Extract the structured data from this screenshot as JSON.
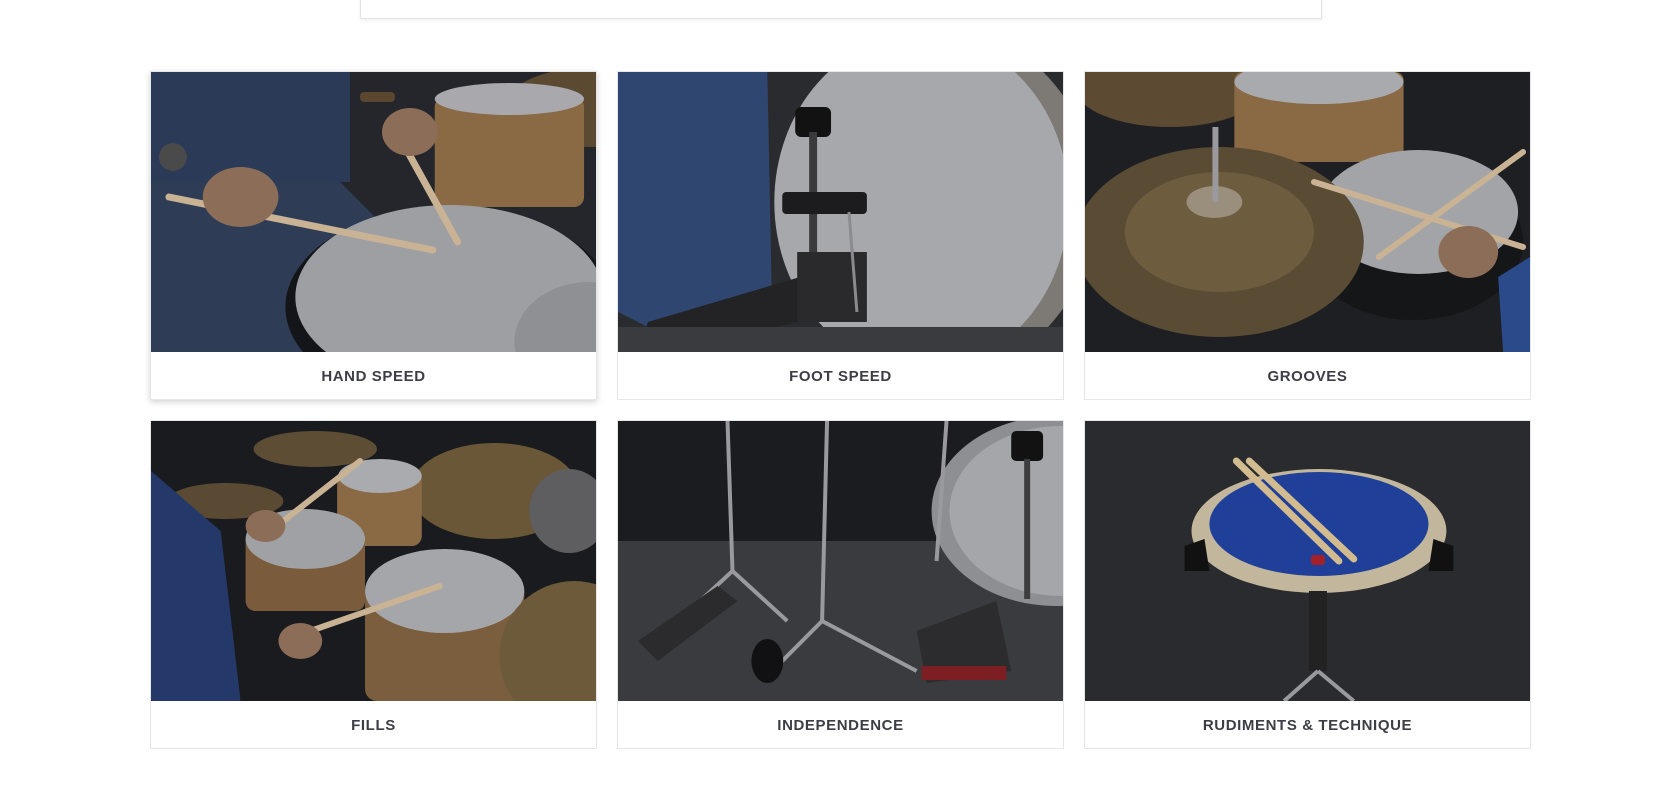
{
  "categories": [
    {
      "label": "HAND SPEED",
      "image": "drummer-hands-snare-photo"
    },
    {
      "label": "FOOT SPEED",
      "image": "bass-drum-pedal-photo"
    },
    {
      "label": "GROOVES",
      "image": "hihat-cymbal-sticks-photo"
    },
    {
      "label": "FILLS",
      "image": "full-drum-kit-photo"
    },
    {
      "label": "INDEPENDENCE",
      "image": "hardware-pedals-stands-photo"
    },
    {
      "label": "RUDIMENTS & TECHNIQUE",
      "image": "blue-practice-pad-photo"
    }
  ],
  "colors": {
    "label_text": "#3d3d46",
    "card_border": "#e6e6e6",
    "practice_pad_blue": "#1f3f99"
  }
}
